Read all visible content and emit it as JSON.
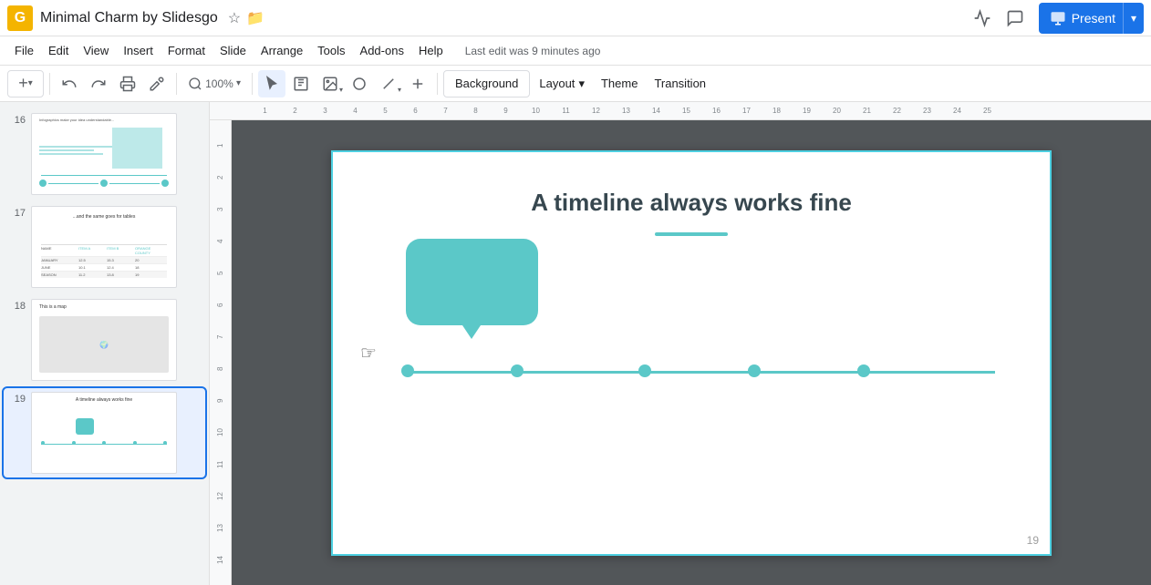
{
  "app": {
    "icon": "G",
    "doc_title": "Minimal Charm by Slidesgo",
    "star_icon": "☆",
    "folder_icon": "🗀"
  },
  "header_buttons": {
    "comment_icon": "💬",
    "analytics_icon": "📈",
    "present_label": "Present",
    "present_arrow": "▾"
  },
  "menu": {
    "items": [
      "File",
      "Edit",
      "View",
      "Insert",
      "Format",
      "Slide",
      "Arrange",
      "Tools",
      "Add-ons",
      "Help"
    ],
    "last_edit": "Last edit was 9 minutes ago"
  },
  "toolbar": {
    "add_label": "+",
    "undo_icon": "↩",
    "redo_icon": "↪",
    "print_icon": "🖨",
    "paint_icon": "🖌",
    "zoom_icon": "⌕",
    "zoom_value": "100%",
    "cursor_icon": "↖",
    "text_icon": "T",
    "image_icon": "🖼",
    "shape_icon": "◯",
    "line_icon": "╱",
    "plus_icon": "+",
    "background_label": "Background",
    "layout_label": "Layout",
    "layout_arrow": "▾",
    "theme_label": "Theme",
    "transition_label": "Transition"
  },
  "slides": [
    {
      "num": "16",
      "type": "chart",
      "active": false
    },
    {
      "num": "17",
      "type": "table",
      "active": false
    },
    {
      "num": "18",
      "type": "map",
      "active": false
    },
    {
      "num": "19",
      "type": "timeline",
      "active": true
    }
  ],
  "slide": {
    "title": "A timeline always works fine",
    "number": "19"
  },
  "ruler": {
    "h_marks": [
      "1",
      "2",
      "3",
      "4",
      "5",
      "6",
      "7",
      "8",
      "9",
      "10",
      "11",
      "12",
      "13",
      "14",
      "15",
      "16",
      "17",
      "18",
      "19",
      "20",
      "21",
      "22",
      "23",
      "24",
      "25"
    ],
    "v_marks": [
      "1",
      "2",
      "3",
      "4",
      "5",
      "6",
      "7",
      "8",
      "9",
      "10",
      "11",
      "12",
      "13",
      "14"
    ]
  },
  "timeline": {
    "dot_positions": [
      80,
      180,
      280,
      380,
      480
    ],
    "accent_color": "#5bc8c8"
  }
}
